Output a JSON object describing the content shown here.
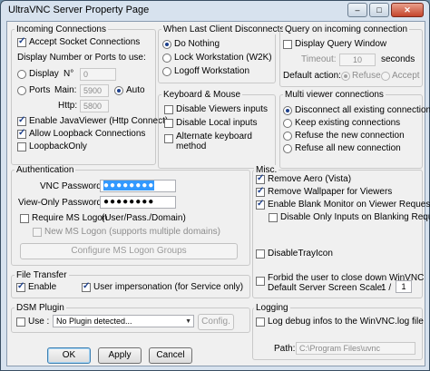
{
  "window": {
    "title": "UltraVNC Server Property Page",
    "min": "–",
    "max": "□",
    "close": "✕"
  },
  "incoming": {
    "title": "Incoming Connections",
    "accept_socket": "Accept Socket Connections",
    "display_heading": "Display Number or Ports to use:",
    "display_label": "Display",
    "n_label": "N°",
    "n_value": "0",
    "ports_label": "Ports",
    "main_label": "Main:",
    "main_value": "5900",
    "auto_label": "Auto",
    "http_label": "Http:",
    "http_value": "5800",
    "javaviewer": "Enable JavaViewer (Http Connect)",
    "loopback": "Allow Loopback Connections",
    "loopbackonly": "LoopbackOnly"
  },
  "disconnect": {
    "title": "When Last Client Disconnects",
    "do_nothing": "Do Nothing",
    "lock": "Lock Workstation (W2K)",
    "logoff": "Logoff Workstation"
  },
  "query": {
    "title": "Query on incoming connection",
    "display_query": "Display Query Window",
    "timeout_label": "Timeout:",
    "timeout_value": "10",
    "seconds": "seconds",
    "default_action": "Default action:",
    "refuse": "Refuse",
    "accept": "Accept"
  },
  "keyboard": {
    "title": "Keyboard & Mouse",
    "disable_viewers": "Disable Viewers inputs",
    "disable_local": "Disable Local inputs",
    "alt_kb_1": "Alternate keyboard",
    "alt_kb_2": "method"
  },
  "multiviewer": {
    "title": "Multi viewer connections",
    "disconnect_all": "Disconnect all existing connections",
    "keep_existing": "Keep existing connections",
    "refuse_new": "Refuse the new connection",
    "refuse_all": "Refuse all new connection"
  },
  "auth": {
    "title": "Authentication",
    "vnc_password_label": "VNC Password:",
    "vnc_password_value": "●●●●●●●●",
    "viewonly_label": "View-Only Password:",
    "viewonly_value": "●●●●●●●●",
    "require_ms": "Require MS Logon",
    "require_ms_note": "(User/Pass./Domain)",
    "new_ms": "New MS Logon (supports multiple domains)",
    "configure": "Configure MS Logon Groups"
  },
  "misc": {
    "title": "Misc.",
    "remove_aero": "Remove Aero (Vista)",
    "remove_wallpaper": "Remove Wallpaper for Viewers",
    "blank_monitor": "Enable Blank Monitor on Viewer Request",
    "disable_only": "Disable Only Inputs on Blanking Request",
    "disable_tray": "DisableTrayIcon",
    "forbid_1": "Forbid the user to close down WinVNC",
    "forbid_2": "Default Server Screen Scale:",
    "scale_prefix": "1 /",
    "scale_value": "1"
  },
  "filetransfer": {
    "title": "File Transfer",
    "enable": "Enable",
    "impersonation": "User impersonation (for Service only)"
  },
  "dsm": {
    "title": "DSM Plugin",
    "use": "Use :",
    "plugin_value": "No Plugin detected...",
    "config": "Config."
  },
  "logging": {
    "title": "Logging",
    "log_debug": "Log debug infos to the WinVNC.log file",
    "path_label": "Path:",
    "path_value": "C:\\Program Files\\uvnc bvba\\UltraVNC"
  },
  "buttons": {
    "ok": "OK",
    "apply": "Apply",
    "cancel": "Cancel"
  },
  "colors": {
    "accent": "#3399ff",
    "frame": "#d7e2ee",
    "close": "#c4452c"
  }
}
